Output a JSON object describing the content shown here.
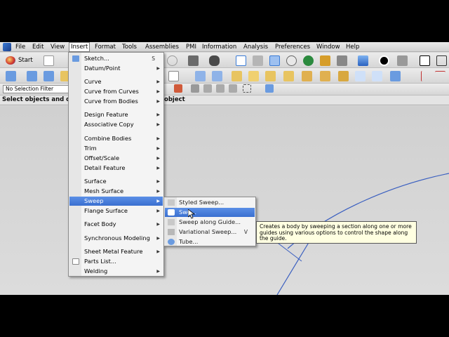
{
  "menubar": {
    "items": [
      "File",
      "Edit",
      "View",
      "Insert",
      "Format",
      "Tools",
      "Assemblies",
      "PMI",
      "Information",
      "Analysis",
      "Preferences",
      "Window",
      "Help"
    ]
  },
  "toolbar": {
    "start_label": "Start",
    "selection_filter": "No Selection Filter"
  },
  "status": {
    "prompt": "Select objects and d",
    "prompt_tail": "object"
  },
  "insert_menu": {
    "items": [
      {
        "label": "Sketch...",
        "shortcut": "S",
        "submenu": false
      },
      {
        "label": "Datum/Point",
        "submenu": true
      },
      {
        "label": "Curve",
        "submenu": true
      },
      {
        "label": "Curve from Curves",
        "submenu": true
      },
      {
        "label": "Curve from Bodies",
        "submenu": true
      },
      {
        "label": "Design Feature",
        "submenu": true
      },
      {
        "label": "Associative Copy",
        "submenu": true
      },
      {
        "label": "Combine Bodies",
        "submenu": true
      },
      {
        "label": "Trim",
        "submenu": true
      },
      {
        "label": "Offset/Scale",
        "submenu": true
      },
      {
        "label": "Detail Feature",
        "submenu": true
      },
      {
        "label": "Surface",
        "submenu": true
      },
      {
        "label": "Mesh Surface",
        "submenu": true
      },
      {
        "label": "Sweep",
        "submenu": true,
        "selected": true
      },
      {
        "label": "Flange Surface",
        "submenu": true
      },
      {
        "label": "Facet Body",
        "submenu": true
      },
      {
        "label": "Synchronous Modeling",
        "submenu": true
      },
      {
        "label": "Sheet Metal Feature",
        "submenu": true
      },
      {
        "label": "Parts List...",
        "submenu": false
      },
      {
        "label": "Welding",
        "submenu": true
      }
    ]
  },
  "sweep_menu": {
    "items": [
      {
        "label": "Styled Sweep..."
      },
      {
        "label": "Swe..."
      },
      {
        "label": "Sweep along Guide..."
      },
      {
        "label": "Variational Sweep...",
        "shortcut": "V"
      },
      {
        "label": "Tube..."
      }
    ]
  },
  "tooltip": {
    "text": "Creates a body by sweeping a section along one or more guides using various options to control the shape along the guide."
  },
  "colors": {
    "selection": "#3a6fd0",
    "geometry": "#3a5fc0",
    "tooltip_bg": "#ffffe1"
  }
}
